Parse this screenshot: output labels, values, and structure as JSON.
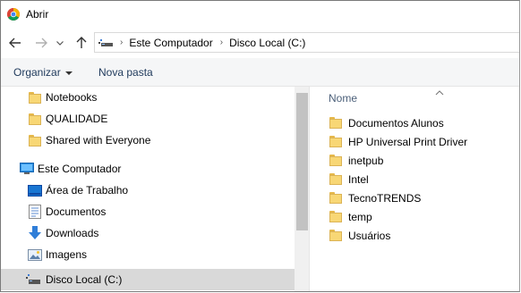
{
  "window": {
    "title": "Abrir",
    "app_icon": "chrome-icon"
  },
  "navigation": {
    "back_icon": "arrow-left-icon",
    "forward_icon": "arrow-right-icon",
    "recent_icon": "chevron-down-icon",
    "up_icon": "arrow-up-icon"
  },
  "address": {
    "root_icon": "computer-icon",
    "breadcrumbs": [
      "Este Computador",
      "Disco Local (C:)"
    ]
  },
  "toolbar": {
    "organize_label": "Organizar",
    "new_folder_label": "Nova pasta"
  },
  "nav_pane": {
    "items": [
      {
        "label": "Notebooks",
        "icon": "folder-icon"
      },
      {
        "label": "QUALIDADE",
        "icon": "folder-icon"
      },
      {
        "label": "Shared with Everyone",
        "icon": "folder-icon"
      },
      {
        "label": "Este Computador",
        "icon": "computer-icon"
      },
      {
        "label": "Área de Trabalho",
        "icon": "desktop-icon"
      },
      {
        "label": "Documentos",
        "icon": "documents-icon"
      },
      {
        "label": "Downloads",
        "icon": "download-icon"
      },
      {
        "label": "Imagens",
        "icon": "pictures-icon"
      },
      {
        "label": "Disco Local (C:)",
        "icon": "drive-icon",
        "selected": true
      }
    ]
  },
  "content": {
    "column_header": "Nome",
    "files": [
      {
        "name": "Documentos Alunos",
        "icon": "folder-icon"
      },
      {
        "name": "HP Universal Print Driver",
        "icon": "folder-icon"
      },
      {
        "name": "inetpub",
        "icon": "folder-icon"
      },
      {
        "name": "Intel",
        "icon": "folder-icon"
      },
      {
        "name": "TecnoTRENDS",
        "icon": "folder-icon"
      },
      {
        "name": "temp",
        "icon": "folder-icon"
      },
      {
        "name": "Usuários",
        "icon": "folder-icon"
      }
    ]
  },
  "colors": {
    "selection": "#d9d9d9",
    "toolbar_bg": "#f5f6f7",
    "command_text": "#1e395b",
    "header_text": "#4c607a",
    "folder_yellow": "#f8d775"
  }
}
